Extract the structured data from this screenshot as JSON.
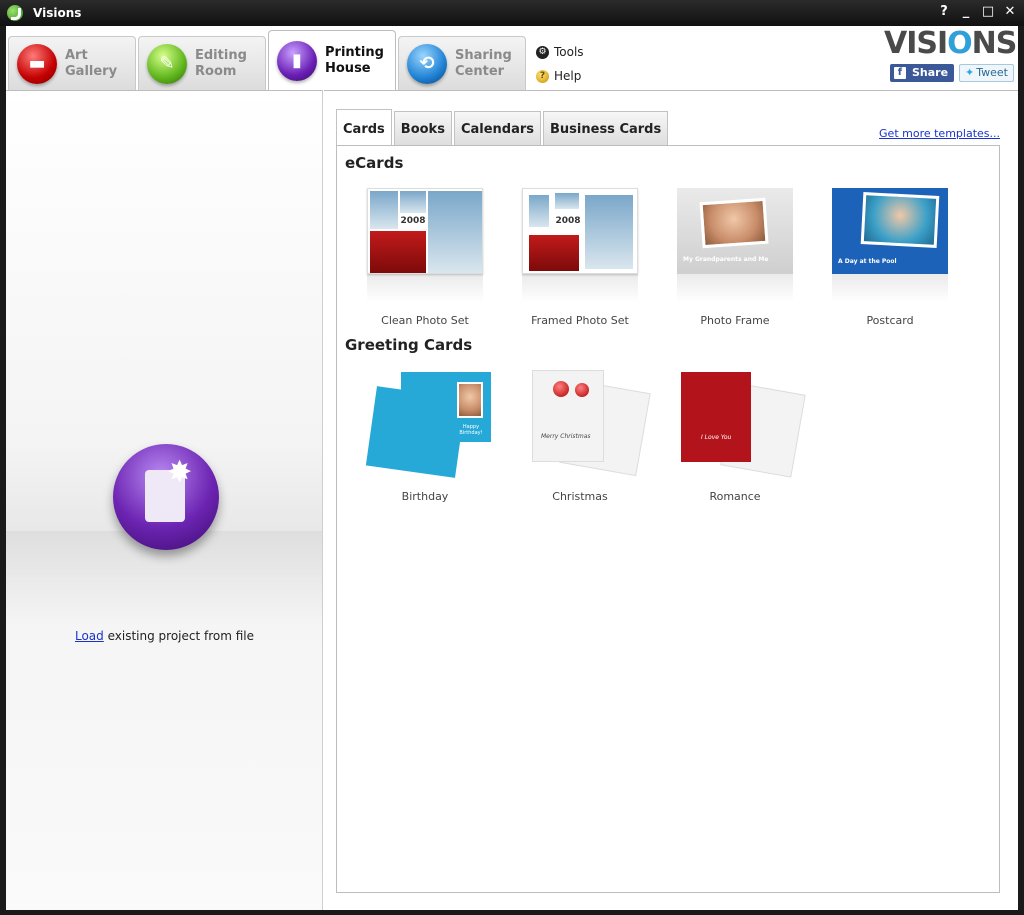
{
  "window": {
    "title": "Visions",
    "controls": [
      "?",
      "_",
      "□",
      "✕"
    ]
  },
  "main_tabs": [
    {
      "label": "Art\nGallery",
      "icon": "film-strip-icon",
      "color": "#c40000",
      "active": false
    },
    {
      "label": "Editing\nRoom",
      "icon": "paint-brush-icon",
      "color": "#5fb51c",
      "active": false
    },
    {
      "label": "Printing\nHouse",
      "icon": "print-document-icon",
      "color": "#6a1fb5",
      "active": true
    },
    {
      "label": "Sharing\nCenter",
      "icon": "share-arrows-icon",
      "color": "#1f82d4",
      "active": false
    }
  ],
  "tools": {
    "tools_label": "Tools",
    "help_label": "Help"
  },
  "brand": {
    "logo_left": "VISI",
    "logo_o": "O",
    "logo_right": "NS",
    "share_label": "Share",
    "tweet_label": "Tweet"
  },
  "left_panel": {
    "load_link": "Load",
    "load_text": " existing project from file"
  },
  "sub_tabs": [
    "Cards",
    "Books",
    "Calendars",
    "Business Cards"
  ],
  "active_sub_tab": "Cards",
  "templates_link": "Get more templates...",
  "sections": {
    "ecards_title": "eCards",
    "greeting_title": "Greeting Cards"
  },
  "ecards": [
    {
      "label": "Clean Photo Set",
      "year": "2008"
    },
    {
      "label": "Framed Photo Set",
      "year": "2008"
    },
    {
      "label": "Photo Frame",
      "caption": "My Grandparents and Me"
    },
    {
      "label": "Postcard",
      "caption": "A Day at the Pool"
    }
  ],
  "greeting_cards": [
    {
      "label": "Birthday",
      "caption": "Happy Birthday!"
    },
    {
      "label": "Christmas",
      "caption": "Merry Christmas"
    },
    {
      "label": "Romance",
      "caption": "I Love You"
    }
  ]
}
